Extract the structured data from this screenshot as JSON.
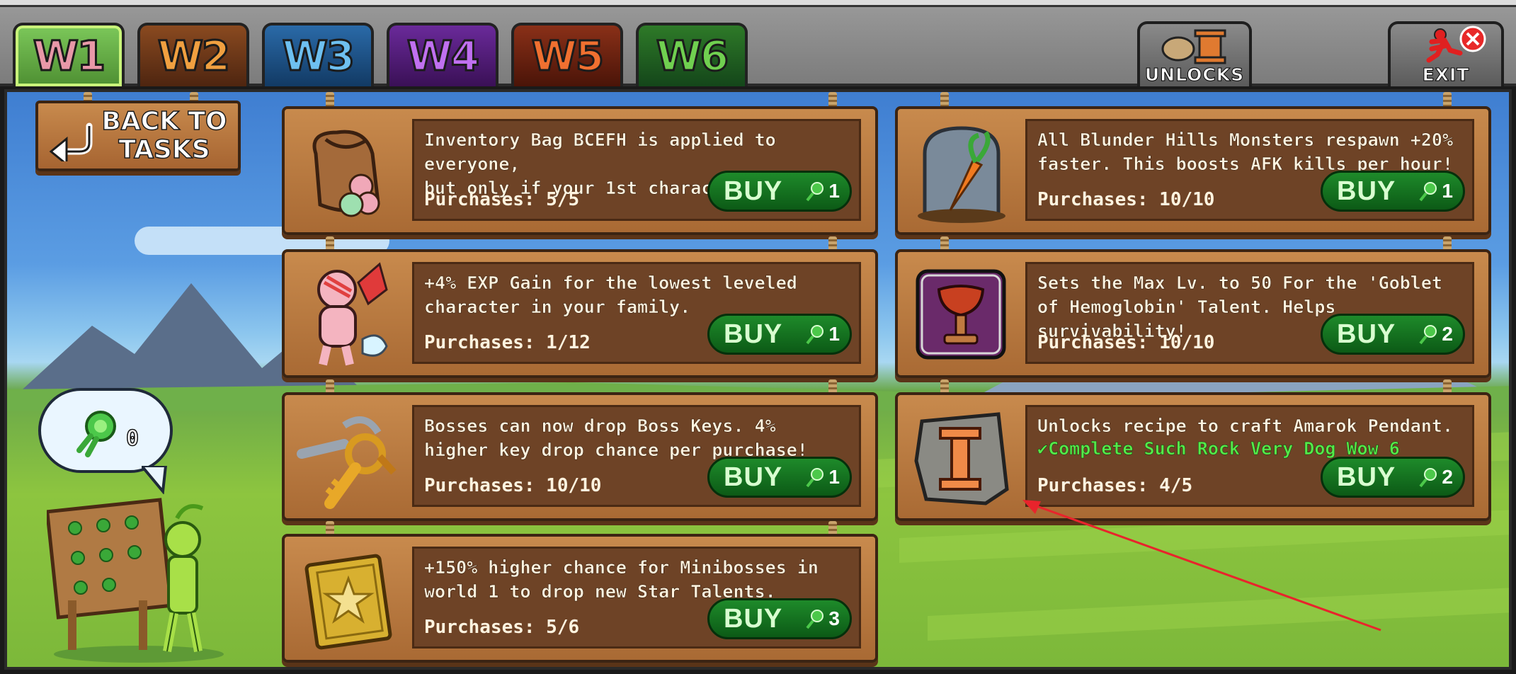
{
  "tabs": [
    {
      "label": "W1",
      "color": "#e898a8",
      "bg": "#6bb04a"
    },
    {
      "label": "W2",
      "color": "#f0a040",
      "bg": "#6a3a1a"
    },
    {
      "label": "W3",
      "color": "#6ec0f0",
      "bg": "#1a4a7a"
    },
    {
      "label": "W4",
      "color": "#c070f0",
      "bg": "#4a1a6a"
    },
    {
      "label": "W5",
      "color": "#f07030",
      "bg": "#6a2010"
    },
    {
      "label": "W6",
      "color": "#70d050",
      "bg": "#1e5a1a"
    }
  ],
  "unlocks_label": "UNLOCKS",
  "exit_label": "EXIT",
  "back_label": "BACK TO\nTASKS",
  "npc_currency_count": "0",
  "buy_label": "BUY",
  "cards": [
    {
      "desc": "Inventory Bag BCEFH is applied to everyone,\nbut only if your 1st character has it.",
      "purchases": "Purchases: 5/5",
      "cost": "1",
      "icon": "inventory-bag-icon"
    },
    {
      "desc": "All Blunder Hills Monsters respawn +20%\nfaster. This boosts AFK kills per hour!",
      "purchases": "Purchases: 10/10",
      "cost": "1",
      "icon": "carrot-grave-icon"
    },
    {
      "desc": "+4% EXP Gain for the lowest leveled\ncharacter in your family.",
      "purchases": "Purchases: 1/12",
      "cost": "1",
      "icon": "baby-character-icon"
    },
    {
      "desc": "Sets the Max Lv. to 50 For the 'Goblet\nof Hemoglobin' Talent. Helps survivability!",
      "purchases": "Purchases: 10/10",
      "cost": "2",
      "icon": "goblet-icon"
    },
    {
      "desc": "Bosses can now drop Boss Keys. 4%\nhigher key drop chance per purchase!",
      "purchases": "Purchases: 10/10",
      "cost": "1",
      "icon": "boss-key-icon"
    },
    {
      "desc": "Unlocks recipe to craft Amarok Pendant.",
      "req": "Complete Such Rock Very Dog Wow 6",
      "purchases": "Purchases: 4/5",
      "cost": "2",
      "icon": "amarok-pendant-icon"
    },
    {
      "desc": "+150% higher chance for Minibosses in\nworld 1 to drop new Star Talents.",
      "purchases": "Purchases: 5/6",
      "cost": "3",
      "icon": "star-talent-book-icon"
    }
  ]
}
